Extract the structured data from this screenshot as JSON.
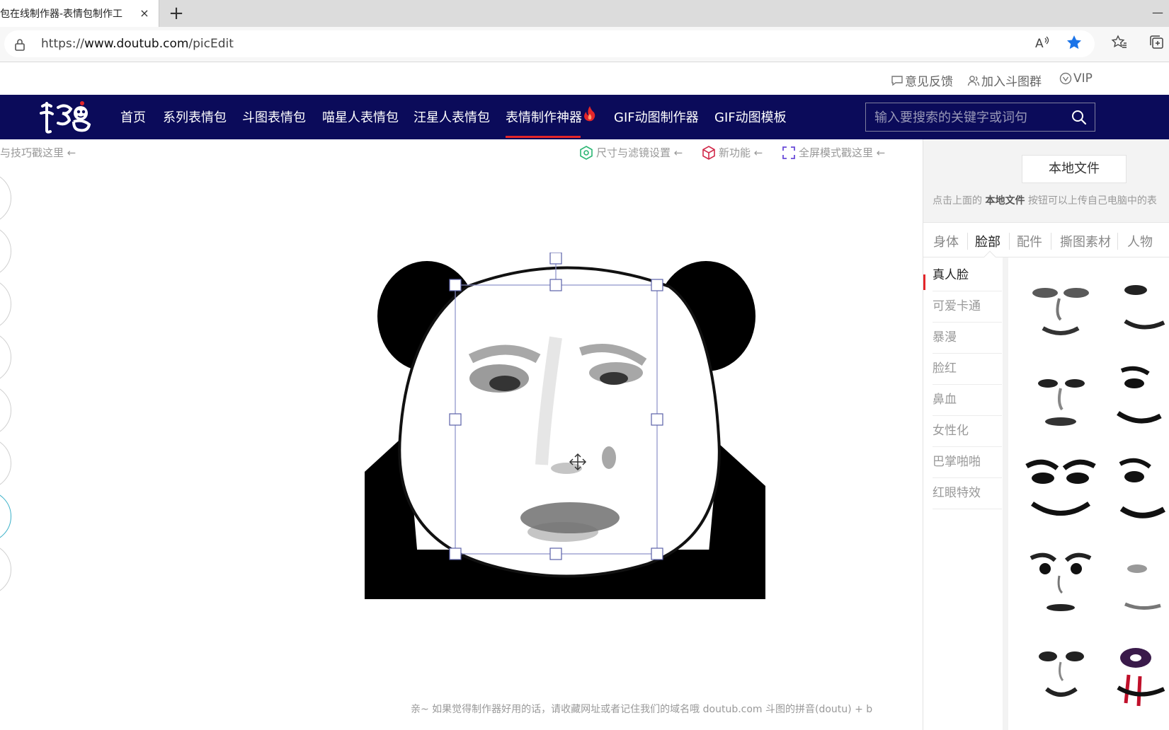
{
  "browser": {
    "tab_title": "包在线制作器-表情包制作工",
    "tab_close": "×",
    "new_tab": "+",
    "minimize": "—",
    "url_prefix": "https://",
    "url_host": "www.doutub.com",
    "url_path": "/picEdit"
  },
  "util": {
    "feedback": "意见反馈",
    "join_group": "加入斗图群",
    "vip": "VIP"
  },
  "nav": {
    "logo": "斗图",
    "items": [
      "首页",
      "系列表情包",
      "斗图表情包",
      "喵星人表情包",
      "汪星人表情包",
      "表情制作神器",
      "GIF动图制作器",
      "GIF动图模板"
    ],
    "active_index": 5,
    "search_placeholder": "输入要搜索的关键字或词句"
  },
  "editor": {
    "tip_left": "与技巧戳这里 ←",
    "tool_size": "尺寸与滤镜设置 ←",
    "tool_new": "新功能 ←",
    "tool_fullscreen": "全屏模式戳这里 ←",
    "footer_note": "亲~ 如果觉得制作器好用的话，请收藏网址或者记住我们的域名哦 doutub.com 斗图的拼音(doutu) + b"
  },
  "panel": {
    "local_file_button": "本地文件",
    "hint_prefix": "点击上面的 ",
    "hint_bold": "本地文件",
    "hint_suffix": " 按钮可以上传自己电脑中的表",
    "tabs": [
      "身体",
      "脸部",
      "配件",
      "撕图素材",
      "人物"
    ],
    "active_tab": 1,
    "categories": [
      "真人脸",
      "可爱卡通",
      "暴漫",
      "脸红",
      "鼻血",
      "女性化",
      "巴掌啪啪",
      "红眼特效"
    ],
    "active_category": 0
  },
  "colors": {
    "nav_bg": "#0b0b5a",
    "accent": "#e3262a",
    "star": "#1a73e8"
  }
}
